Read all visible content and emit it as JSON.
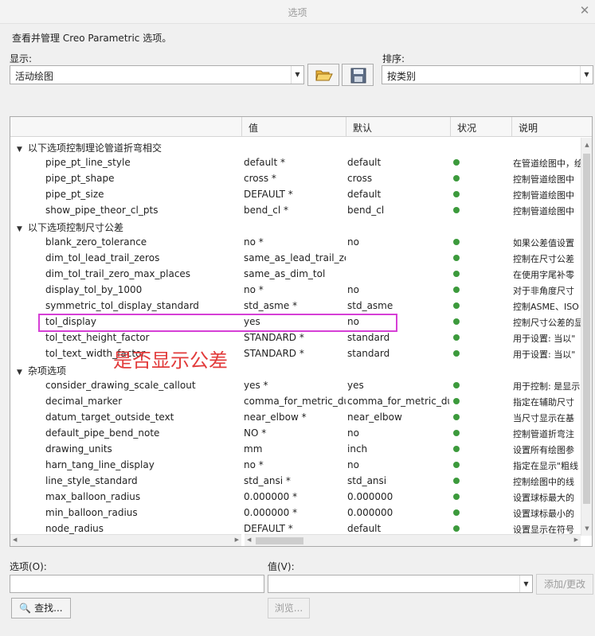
{
  "window": {
    "title": "选项",
    "close_glyph": "✕"
  },
  "description": "查看并管理 Creo Parametric 选项。",
  "display": {
    "label": "显示:",
    "value": "活动绘图"
  },
  "sort": {
    "label": "排序:",
    "value": "按类别"
  },
  "toolbar": {
    "open_icon": "folder-open-icon",
    "save_icon": "floppy-save-icon"
  },
  "table": {
    "columns": [
      "",
      "值",
      "默认",
      "状况",
      "说明"
    ],
    "groups": [
      {
        "title": "以下选项控制理论管道折弯相交",
        "items": [
          {
            "name": "pipe_pt_line_style",
            "value": "default *",
            "default": "default",
            "desc": "在管道绘图中，绘"
          },
          {
            "name": "pipe_pt_shape",
            "value": "cross *",
            "default": "cross",
            "desc": "控制管道绘图中"
          },
          {
            "name": "pipe_pt_size",
            "value": "DEFAULT *",
            "default": "default",
            "desc": "控制管道绘图中"
          },
          {
            "name": "show_pipe_theor_cl_pts",
            "value": "bend_cl *",
            "default": "bend_cl",
            "desc": "控制管道绘图中"
          }
        ]
      },
      {
        "title": "以下选项控制尺寸公差",
        "items": [
          {
            "name": "blank_zero_tolerance",
            "value": "no *",
            "default": "no",
            "desc": "如果公差值设置"
          },
          {
            "name": "dim_tol_lead_trail_zeros",
            "value": "same_as_lead_trail_zer",
            "default": "",
            "desc": "控制在尺寸公差"
          },
          {
            "name": "dim_tol_trail_zero_max_places",
            "value": "same_as_dim_tol",
            "default": "",
            "desc": "在使用字尾补零"
          },
          {
            "name": "display_tol_by_1000",
            "value": "no *",
            "default": "no",
            "desc": "对于非角度尺寸"
          },
          {
            "name": "symmetric_tol_display_standard",
            "value": "std_asme *",
            "default": "std_asme",
            "desc": "控制ASME、ISO"
          },
          {
            "name": "tol_display",
            "value": "yes",
            "default": "no",
            "desc": "控制尺寸公差的显"
          },
          {
            "name": "tol_text_height_factor",
            "value": "STANDARD *",
            "default": "standard",
            "desc": "用于设置: 当以\""
          },
          {
            "name": "tol_text_width_factor",
            "value": "STANDARD *",
            "default": "standard",
            "desc": "用于设置: 当以\""
          }
        ]
      },
      {
        "title": "杂项选项",
        "items": [
          {
            "name": "consider_drawing_scale_callout",
            "value": "yes *",
            "default": "yes",
            "desc": "用于控制: 是显示"
          },
          {
            "name": "decimal_marker",
            "value": "comma_for_metric_du",
            "default": "comma_for_metric_du",
            "desc": "指定在辅助尺寸"
          },
          {
            "name": "datum_target_outside_text",
            "value": "near_elbow *",
            "default": "near_elbow",
            "desc": "当尺寸显示在基"
          },
          {
            "name": "default_pipe_bend_note",
            "value": "NO *",
            "default": "no",
            "desc": "控制管道折弯注"
          },
          {
            "name": "drawing_units",
            "value": "mm",
            "default": "inch",
            "desc": "设置所有绘图参"
          },
          {
            "name": "harn_tang_line_display",
            "value": "no *",
            "default": "no",
            "desc": "指定在显示\"粗线"
          },
          {
            "name": "line_style_standard",
            "value": "std_ansi *",
            "default": "std_ansi",
            "desc": "控制绘图中的线"
          },
          {
            "name": "max_balloon_radius",
            "value": "0.000000 *",
            "default": "0.000000",
            "desc": "设置球标最大的"
          },
          {
            "name": "min_balloon_radius",
            "value": "0.000000 *",
            "default": "0.000000",
            "desc": "设置球标最小的"
          },
          {
            "name": "node_radius",
            "value": "DEFAULT *",
            "default": "default",
            "desc": "设置显示在符号"
          }
        ]
      }
    ]
  },
  "annotation": "是否显示公差",
  "option_field": {
    "label": "选项(O):",
    "value": ""
  },
  "value_field": {
    "label": "值(V):",
    "value": ""
  },
  "buttons": {
    "add_change": "添加/更改",
    "find": "查找...",
    "browse": "浏览..."
  },
  "colors": {
    "status_dot": "#3c9a3c",
    "highlight": "#d63fd6",
    "annotation": "#e23b3b"
  }
}
